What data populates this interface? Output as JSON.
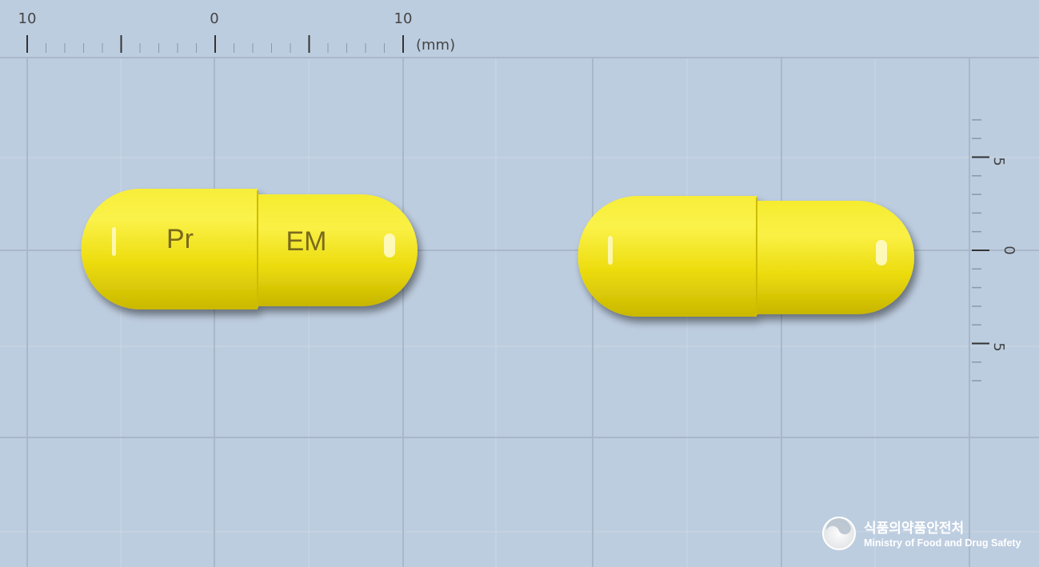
{
  "top_ruler": {
    "labels": [
      "10",
      "0",
      "10"
    ],
    "unit": "(mm)"
  },
  "side_ruler": {
    "labels": [
      "5",
      "0",
      "5"
    ]
  },
  "capsule_front": {
    "imprint_left": "Pr",
    "imprint_right": "EM",
    "color": "#f2e51a"
  },
  "capsule_back": {
    "color": "#f5ea1c"
  },
  "logo": {
    "name_korean": "식품의약품안전처",
    "name_english": "Ministry of Food and Drug Safety"
  }
}
